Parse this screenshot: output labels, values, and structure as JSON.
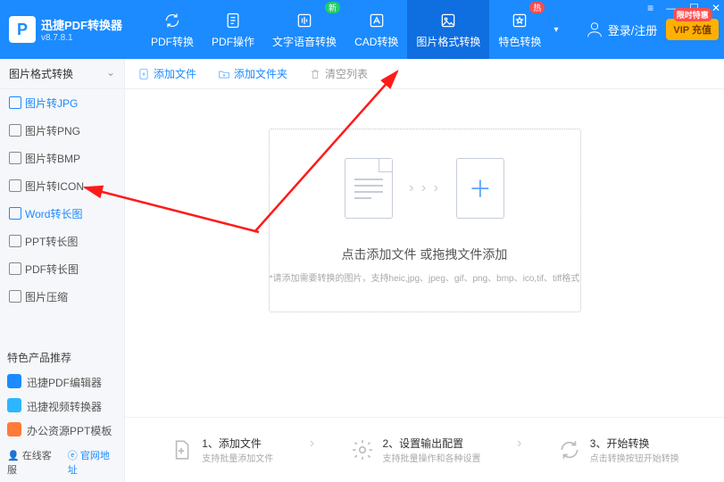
{
  "app": {
    "title": "迅捷PDF转换器",
    "version": "v8.7.8.1"
  },
  "nav": {
    "items": [
      {
        "label": "PDF转换"
      },
      {
        "label": "PDF操作"
      },
      {
        "label": "文字语音转换",
        "badge_new": "新"
      },
      {
        "label": "CAD转换"
      },
      {
        "label": "图片格式转换"
      },
      {
        "label": "特色转换",
        "badge_hot": "热"
      }
    ]
  },
  "header": {
    "login_label": "登录/注册",
    "vip_label": "VIP 充值",
    "vip_badge": "限时特惠"
  },
  "window": {
    "menu": "≡",
    "min": "—",
    "max": "☐",
    "close": "✕"
  },
  "sidebar": {
    "title": "图片格式转换",
    "items": [
      {
        "label": "图片转JPG"
      },
      {
        "label": "图片转PNG"
      },
      {
        "label": "图片转BMP"
      },
      {
        "label": "图片转ICON"
      },
      {
        "label": "Word转长图"
      },
      {
        "label": "PPT转长图"
      },
      {
        "label": "PDF转长图"
      },
      {
        "label": "图片压缩"
      }
    ],
    "rec_title": "特色产品推荐",
    "recs": [
      {
        "label": "迅捷PDF编辑器",
        "color": "#1b8bff"
      },
      {
        "label": "迅捷视频转换器",
        "color": "#2bb6ff"
      },
      {
        "label": "办公资源PPT模板",
        "color": "#ff7b3a"
      }
    ],
    "foot": {
      "kf": "在线客服",
      "web": "官网地址"
    }
  },
  "toolbar": {
    "add_file": "添加文件",
    "add_folder": "添加文件夹",
    "clear_list": "清空列表"
  },
  "dropzone": {
    "main": "点击添加文件 或拖拽文件添加",
    "sub": "*请添加需要转换的图片，支持heic,jpg、jpeg、gif、png、bmp、ico,tif、tiff格式"
  },
  "steps": {
    "s1_title": "1、添加文件",
    "s1_sub": "支持批量添加文件",
    "s2_title": "2、设置输出配置",
    "s2_sub": "支持批量操作和各种设置",
    "s3_title": "3、开始转换",
    "s3_sub": "点击转换按钮开始转换"
  }
}
